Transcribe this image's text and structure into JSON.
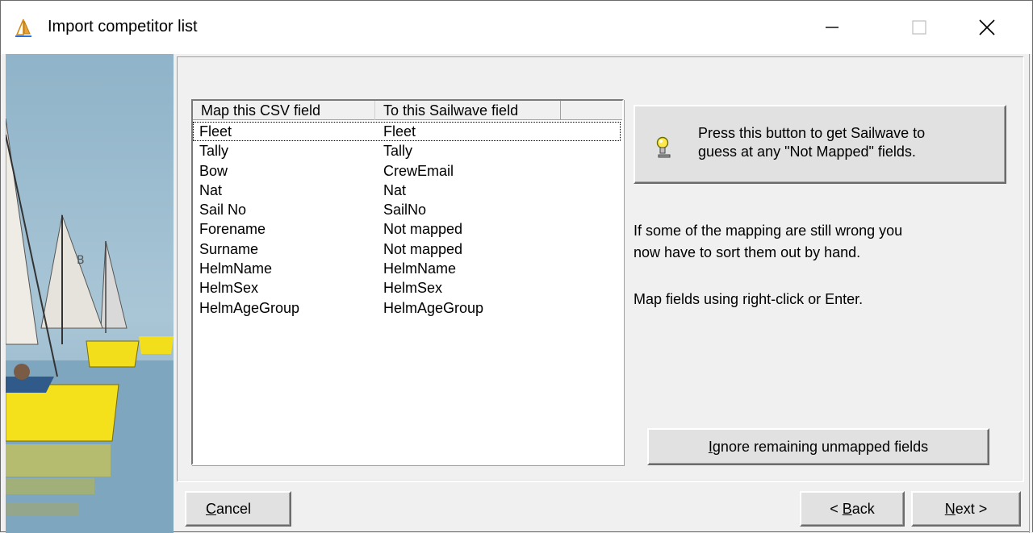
{
  "window": {
    "title": "Import competitor list",
    "minimize_glyph": "—",
    "close_glyph": "✕"
  },
  "list": {
    "columns": [
      "Map this CSV field",
      "To this Sailwave field"
    ],
    "rows": [
      [
        "Fleet",
        "Fleet"
      ],
      [
        "Tally",
        "Tally"
      ],
      [
        "Bow",
        "CrewEmail"
      ],
      [
        "Nat",
        "Nat"
      ],
      [
        "Sail No",
        "SailNo"
      ],
      [
        "Forename",
        "Not mapped"
      ],
      [
        "Surname",
        "Not mapped"
      ],
      [
        "HelmName",
        "HelmName"
      ],
      [
        "HelmSex",
        "HelmSex"
      ],
      [
        "HelmAgeGroup",
        "HelmAgeGroup"
      ]
    ]
  },
  "guess_button": {
    "line1": "Press this button to get Sailwave to",
    "line2": "guess at any \"Not Mapped\" fields.",
    "icon": "lightbulb-icon"
  },
  "info": {
    "line1": "If some of the mapping are still wrong you",
    "line2": "now have to sort them out by hand.",
    "line3": "Map fields using right-click or Enter."
  },
  "buttons": {
    "ignore_prefix": "",
    "ignore_underline": "I",
    "ignore_rest": "gnore remaining unmapped fields",
    "cancel_underline": "C",
    "cancel_rest": "ancel",
    "back_prefix": "< ",
    "back_underline": "B",
    "back_rest": "ack",
    "next_underline": "N",
    "next_rest": "ext >"
  }
}
